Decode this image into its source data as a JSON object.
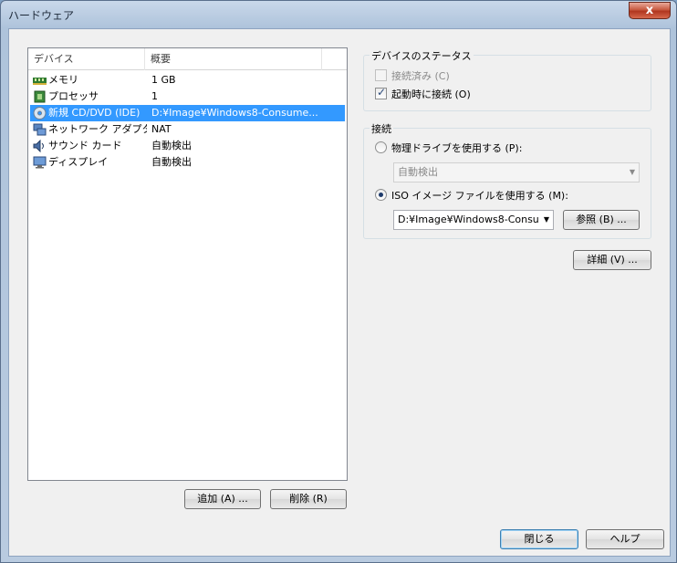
{
  "window": {
    "title": "ハードウェア",
    "close_glyph": "x"
  },
  "device_list": {
    "columns": [
      "デバイス",
      "概要"
    ],
    "rows": [
      {
        "icon": "memory-icon",
        "name": "メモリ",
        "summary": "1 GB",
        "selected": false
      },
      {
        "icon": "processor-icon",
        "name": "プロセッサ",
        "summary": "1",
        "selected": false
      },
      {
        "icon": "cd-dvd-icon",
        "name": "新規 CD/DVD (IDE)",
        "summary": "D:¥Image¥Windows8-Consume...",
        "selected": true
      },
      {
        "icon": "network-adapter-icon",
        "name": "ネットワーク アダプタ",
        "summary": "NAT",
        "selected": false
      },
      {
        "icon": "sound-card-icon",
        "name": "サウンド カード",
        "summary": "自動検出",
        "selected": false
      },
      {
        "icon": "display-icon",
        "name": "ディスプレイ",
        "summary": "自動検出",
        "selected": false
      }
    ],
    "add_label": "追加 (A) ...",
    "remove_label": "削除 (R)"
  },
  "device_status": {
    "title": "デバイスのステータス",
    "connected_label": "接続済み (C)",
    "connected_checked": false,
    "connect_on_start_label": "起動時に接続 (O)",
    "connect_on_start_checked": true
  },
  "connection": {
    "title": "接続",
    "physical_label": "物理ドライブを使用する (P):",
    "physical_value": "自動検出",
    "iso_label": "ISO イメージ ファイルを使用する (M):",
    "iso_value": "D:¥Image¥Windows8-Consu",
    "browse_label": "参照 (B) ..."
  },
  "advanced_label": "詳細 (V) ...",
  "footer": {
    "close_label": "閉じる",
    "help_label": "ヘルプ"
  },
  "colors": {
    "selection": "#3399ff",
    "window_frame": "#aec3db"
  }
}
